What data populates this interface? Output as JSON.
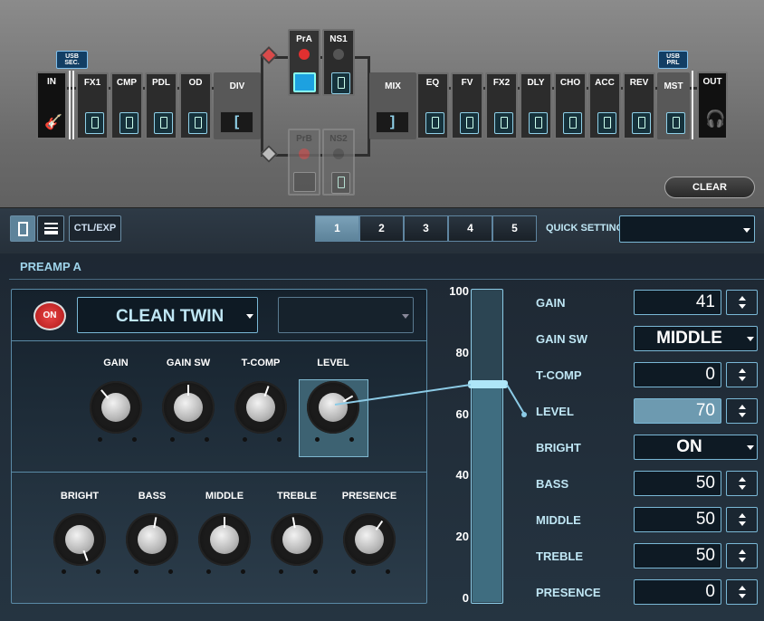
{
  "chain": {
    "in": "IN",
    "out": "OUT",
    "div": "DIV",
    "mix": "MIX",
    "usb_sec": [
      "USB",
      "SEC."
    ],
    "usb_prl": [
      "USB",
      "PRL"
    ],
    "pre_blocks": [
      "FX1",
      "CMP",
      "PDL",
      "OD"
    ],
    "post_blocks": [
      "EQ",
      "FV",
      "FX2",
      "DLY",
      "CHO",
      "ACC",
      "REV",
      "MST"
    ],
    "top_path": [
      "PrA",
      "NS1"
    ],
    "bottom_path": [
      "PrB",
      "NS2"
    ],
    "clear_label": "CLEAR"
  },
  "toolbar": {
    "ctl_exp": "CTL/EXP",
    "numbers": [
      "1",
      "2",
      "3",
      "4",
      "5"
    ],
    "selected_number": "1",
    "quick_setting": "QUICK SETTING",
    "quick_setting_value": ""
  },
  "section_title": "PREAMP A",
  "amp": {
    "on_label": "ON",
    "type": "CLEAN TWIN",
    "second_select": ""
  },
  "knobs_top": [
    "GAIN",
    "GAIN SW",
    "T-COMP",
    "LEVEL"
  ],
  "knobs_bottom": [
    "BRIGHT",
    "BASS",
    "MIDDLE",
    "TREBLE",
    "PRESENCE"
  ],
  "slider": {
    "ticks": [
      "100",
      "80",
      "60",
      "40",
      "20",
      "0"
    ],
    "value": 70,
    "max": 100
  },
  "params": [
    {
      "name": "GAIN",
      "value": "41",
      "kind": "num"
    },
    {
      "name": "GAIN SW",
      "value": "MIDDLE",
      "kind": "sel"
    },
    {
      "name": "T-COMP",
      "value": "0",
      "kind": "num"
    },
    {
      "name": "LEVEL",
      "value": "70",
      "kind": "num",
      "selected": true
    },
    {
      "name": "BRIGHT",
      "value": "ON",
      "kind": "sel"
    },
    {
      "name": "BASS",
      "value": "50",
      "kind": "num"
    },
    {
      "name": "MIDDLE",
      "value": "50",
      "kind": "num"
    },
    {
      "name": "TREBLE",
      "value": "50",
      "kind": "num"
    },
    {
      "name": "PRESENCE",
      "value": "0",
      "kind": "num"
    }
  ],
  "colors": {
    "accent": "#7fc8e6",
    "on_red": "#d62b2b",
    "selected": "#6d9ab0"
  }
}
